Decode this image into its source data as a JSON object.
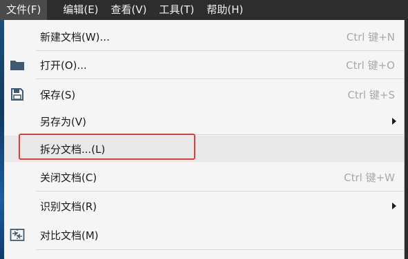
{
  "menubar": {
    "items": [
      {
        "label": "文件(F)",
        "active": true
      },
      {
        "label": "编辑(E)",
        "active": false
      },
      {
        "label": "查看(V)",
        "active": false
      },
      {
        "label": "工具(T)",
        "active": false
      },
      {
        "label": "帮助(H)",
        "active": false
      }
    ]
  },
  "file_menu": {
    "items": [
      {
        "label": "新建文档(W)...",
        "shortcut": "Ctrl 键+N",
        "icon": null,
        "submenu": false
      },
      {
        "label": "打开(O)...",
        "shortcut": "Ctrl 键+O",
        "icon": "folder-icon",
        "submenu": false
      },
      {
        "label": "保存(S)",
        "shortcut": "Ctrl 键+S",
        "icon": "save-icon",
        "submenu": false
      },
      {
        "label": "另存为(V)",
        "shortcut": "",
        "icon": null,
        "submenu": true
      },
      {
        "label": "拆分文档...(L)",
        "shortcut": "",
        "icon": null,
        "submenu": false,
        "hovered": true,
        "highlighted": true
      },
      {
        "label": "关闭文档(C)",
        "shortcut": "Ctrl 键+W",
        "icon": null,
        "submenu": false
      },
      {
        "label": "识别文档(R)",
        "shortcut": "",
        "icon": null,
        "submenu": true
      },
      {
        "label": "对比文档(M)",
        "shortcut": "",
        "icon": "compare-icon",
        "submenu": false
      }
    ]
  },
  "colors": {
    "menubar_bg": "#2d2d2d",
    "menu_bg": "#f5f5f5",
    "hover_bg": "#e8e8e8",
    "highlight_border": "#e53935",
    "icon_color": "#3d5a73"
  }
}
